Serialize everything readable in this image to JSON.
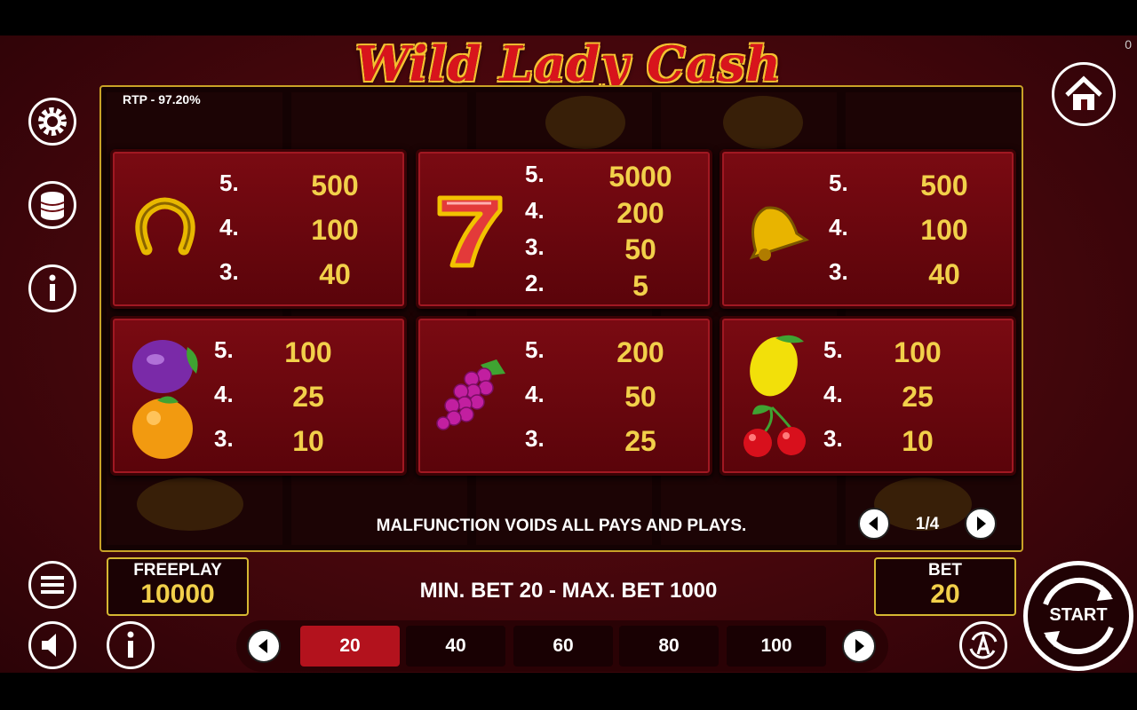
{
  "corner_counter": "0",
  "title": "Wild Lady Cash",
  "rtp": "RTP - 97.20%",
  "paytable": [
    {
      "symbol": "horseshoe-icon",
      "rows": [
        {
          "count": "5.",
          "value": "500"
        },
        {
          "count": "4.",
          "value": "100"
        },
        {
          "count": "3.",
          "value": "40"
        }
      ]
    },
    {
      "symbol": "seven-icon",
      "rows": [
        {
          "count": "5.",
          "value": "5000"
        },
        {
          "count": "4.",
          "value": "200"
        },
        {
          "count": "3.",
          "value": "50"
        },
        {
          "count": "2.",
          "value": "5"
        }
      ]
    },
    {
      "symbol": "bell-icon",
      "rows": [
        {
          "count": "5.",
          "value": "500"
        },
        {
          "count": "4.",
          "value": "100"
        },
        {
          "count": "3.",
          "value": "40"
        }
      ]
    },
    {
      "symbol": "plum-orange-icon",
      "rows": [
        {
          "count": "5.",
          "value": "100"
        },
        {
          "count": "4.",
          "value": "25"
        },
        {
          "count": "3.",
          "value": "10"
        }
      ]
    },
    {
      "symbol": "grapes-icon",
      "rows": [
        {
          "count": "5.",
          "value": "200"
        },
        {
          "count": "4.",
          "value": "50"
        },
        {
          "count": "3.",
          "value": "25"
        }
      ]
    },
    {
      "symbol": "lemon-cherry-icon",
      "rows": [
        {
          "count": "5.",
          "value": "100"
        },
        {
          "count": "4.",
          "value": "25"
        },
        {
          "count": "3.",
          "value": "10"
        }
      ]
    }
  ],
  "disclaimer": "MALFUNCTION VOIDS ALL PAYS AND PLAYS.",
  "pager": "1/4",
  "freeplay": {
    "label": "FREEPLAY",
    "value": "10000"
  },
  "bet": {
    "label": "BET",
    "value": "20"
  },
  "bet_limits": "MIN. BET 20 - MAX. BET 1000",
  "bet_options": [
    "20",
    "40",
    "60",
    "80",
    "100"
  ],
  "selected_bet": "20",
  "start_label": "START",
  "colors": {
    "accent_gold": "#f2d04a",
    "card_red": "#7a0a12",
    "selected_red": "#b3121d"
  }
}
